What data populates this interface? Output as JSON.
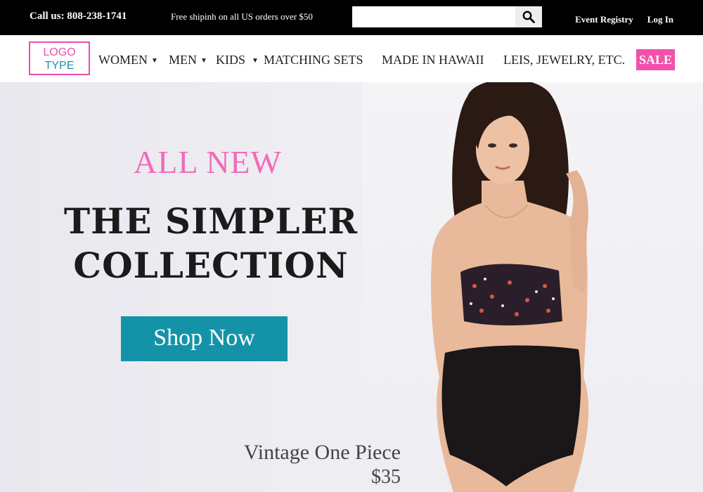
{
  "topbar": {
    "phone": "Call us: 808-238-1741",
    "promo": "Free shipinh on all US orders over $50",
    "search_placeholder": "",
    "search_icon": "search-icon",
    "links": [
      "Event Registry",
      "Log In"
    ]
  },
  "logo": {
    "line1": "LOGO",
    "line2": "TYPE"
  },
  "nav": {
    "items": [
      {
        "label": "WOMEN",
        "caret": "▼"
      },
      {
        "label": "MEN",
        "caret": "▼"
      },
      {
        "label": "KIDS",
        "caret": "▼"
      },
      {
        "label": "MATCHING SETS",
        "caret": ""
      },
      {
        "label": "MADE IN HAWAII",
        "caret": ""
      },
      {
        "label": "LEIS, JEWELRY, ETC.",
        "caret": ""
      }
    ],
    "sale": "SALE"
  },
  "hero": {
    "kicker": "ALL NEW",
    "headline_line1": "THE SIMPLER",
    "headline_line2": "COLLECTION",
    "cta": "Shop Now",
    "product_name": "Vintage One Piece",
    "product_price": "$35"
  },
  "colors": {
    "accent_pink": "#f250ab",
    "accent_teal": "#1493a8",
    "topbar": "#000000"
  }
}
